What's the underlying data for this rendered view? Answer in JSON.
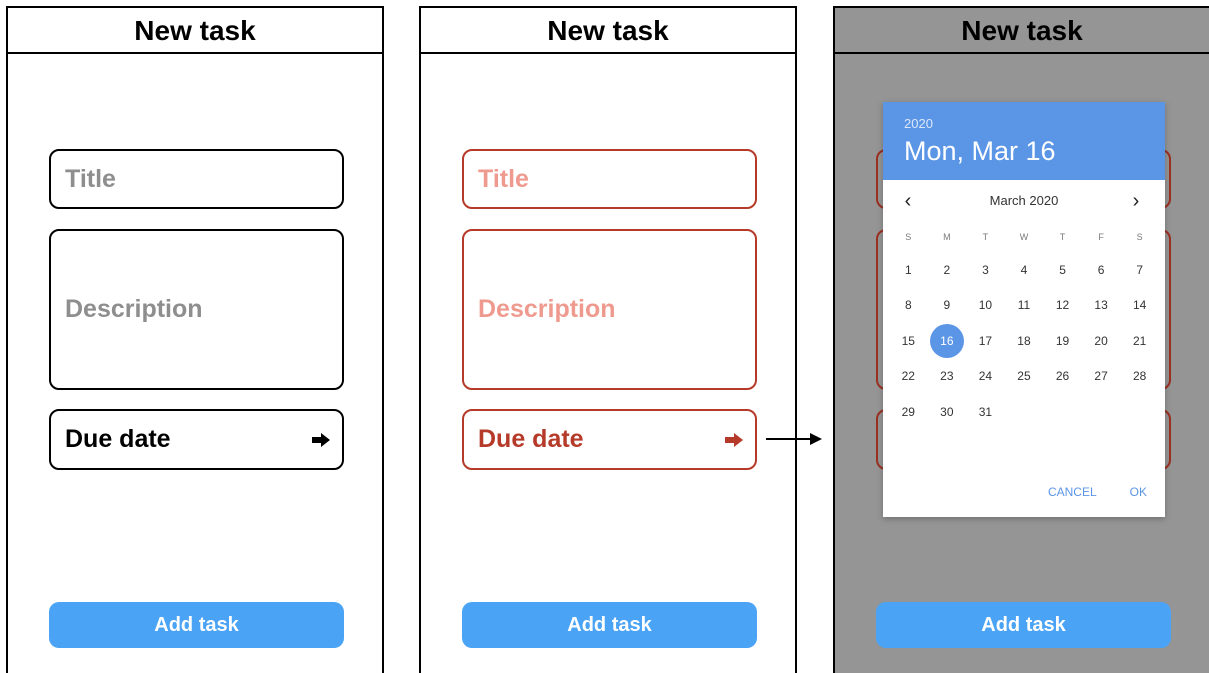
{
  "screens": [
    {
      "header": "New task",
      "title_placeholder": "Title",
      "description_placeholder": "Description",
      "due_date_label": "Due date",
      "button": "Add task"
    },
    {
      "header": "New task",
      "title_placeholder": "Title",
      "description_placeholder": "Description",
      "due_date_label": "Due date",
      "button": "Add task"
    },
    {
      "header": "New task",
      "button": "Add task",
      "picker": {
        "year": "2020",
        "selected_date": "Mon, Mar 16",
        "month_label": "March 2020",
        "prev_icon": "chevron-left-icon",
        "next_icon": "chevron-right-icon",
        "weekdays": [
          "S",
          "M",
          "T",
          "W",
          "T",
          "F",
          "S"
        ],
        "first_day_offset": 0,
        "days": [
          "1",
          "2",
          "3",
          "4",
          "5",
          "6",
          "7",
          "8",
          "9",
          "10",
          "11",
          "12",
          "13",
          "14",
          "15",
          "16",
          "17",
          "18",
          "19",
          "20",
          "21",
          "22",
          "23",
          "24",
          "25",
          "26",
          "27",
          "28",
          "29",
          "30",
          "31"
        ],
        "selected_day": "16",
        "cancel": "CANCEL",
        "ok": "OK"
      }
    }
  ],
  "colors": {
    "error_red": "#b63a29",
    "placeholder_pink": "#ef9a8f",
    "button_blue": "#4aa3f5",
    "picker_blue": "#5b95e6",
    "overlay_gray": "#959595"
  },
  "icons": {
    "due_arrow": "arrow-right-icon",
    "flow_arrow": "long-arrow-right-icon"
  }
}
